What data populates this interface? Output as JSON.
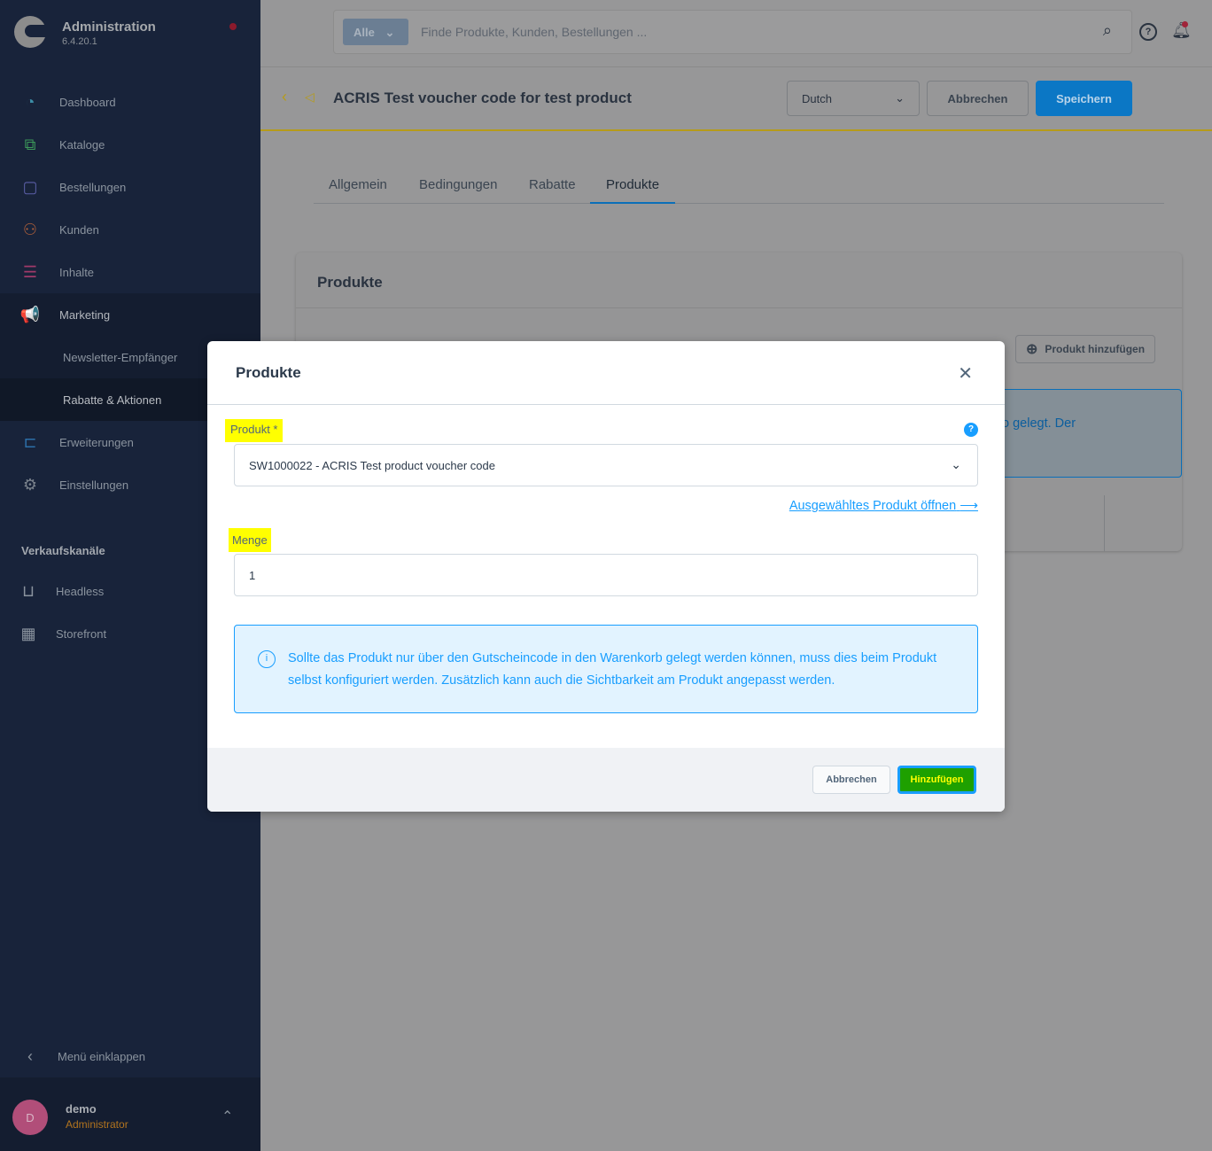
{
  "sidebar": {
    "title": "Administration",
    "version": "6.4.20.1",
    "items": [
      {
        "label": "Dashboard",
        "icon": "dashboard-icon"
      },
      {
        "label": "Kataloge",
        "icon": "catalog-icon"
      },
      {
        "label": "Bestellungen",
        "icon": "orders-icon"
      },
      {
        "label": "Kunden",
        "icon": "customers-icon"
      },
      {
        "label": "Inhalte",
        "icon": "content-icon"
      },
      {
        "label": "Marketing",
        "icon": "megaphone-icon"
      },
      {
        "label": "Newsletter-Empfänger"
      },
      {
        "label": "Rabatte & Aktionen"
      },
      {
        "label": "Erweiterungen",
        "icon": "plug-icon"
      },
      {
        "label": "Einstellungen",
        "icon": "gear-icon"
      }
    ],
    "section": "Verkaufskanäle",
    "channels": [
      {
        "label": "Headless"
      },
      {
        "label": "Storefront"
      }
    ],
    "collapse": "Menü einklappen",
    "user": {
      "initial": "D",
      "name": "demo",
      "role": "Administrator"
    }
  },
  "search": {
    "type": "Alle",
    "placeholder": "Finde Produkte, Kunden, Bestellungen ..."
  },
  "smartbar": {
    "title": "ACRIS Test voucher code for test product",
    "language": "Dutch",
    "cancel": "Abbrechen",
    "save": "Speichern"
  },
  "tabs": [
    {
      "label": "Allgemein"
    },
    {
      "label": "Bedingungen"
    },
    {
      "label": "Rabatte"
    },
    {
      "label": "Produkte",
      "active": true
    }
  ],
  "card": {
    "title": "Produkte",
    "add_button": "Produkt hinzufügen",
    "info_fragment": "o gelegt. Der"
  },
  "modal": {
    "title": "Produkte",
    "product_label": "Produkt *",
    "product_value": "SW1000022 - ACRIS Test product voucher code",
    "open_link": "Ausgewähltes Produkt öffnen",
    "quantity_label": "Menge",
    "quantity_value": "1",
    "info": "Sollte das Produkt nur über den Gutscheincode in den Warenkorb gelegt werden können, muss dies beim Produkt selbst konfiguriert werden. Zusätzlich kann auch die Sichtbarkeit am Produkt angepasst werden.",
    "cancel": "Abbrechen",
    "add": "Hinzufügen"
  },
  "colors": {
    "primary": "#189eff",
    "sidebar": "#18233a",
    "highlight": "#ffff00",
    "add_button": "#1ea000"
  }
}
